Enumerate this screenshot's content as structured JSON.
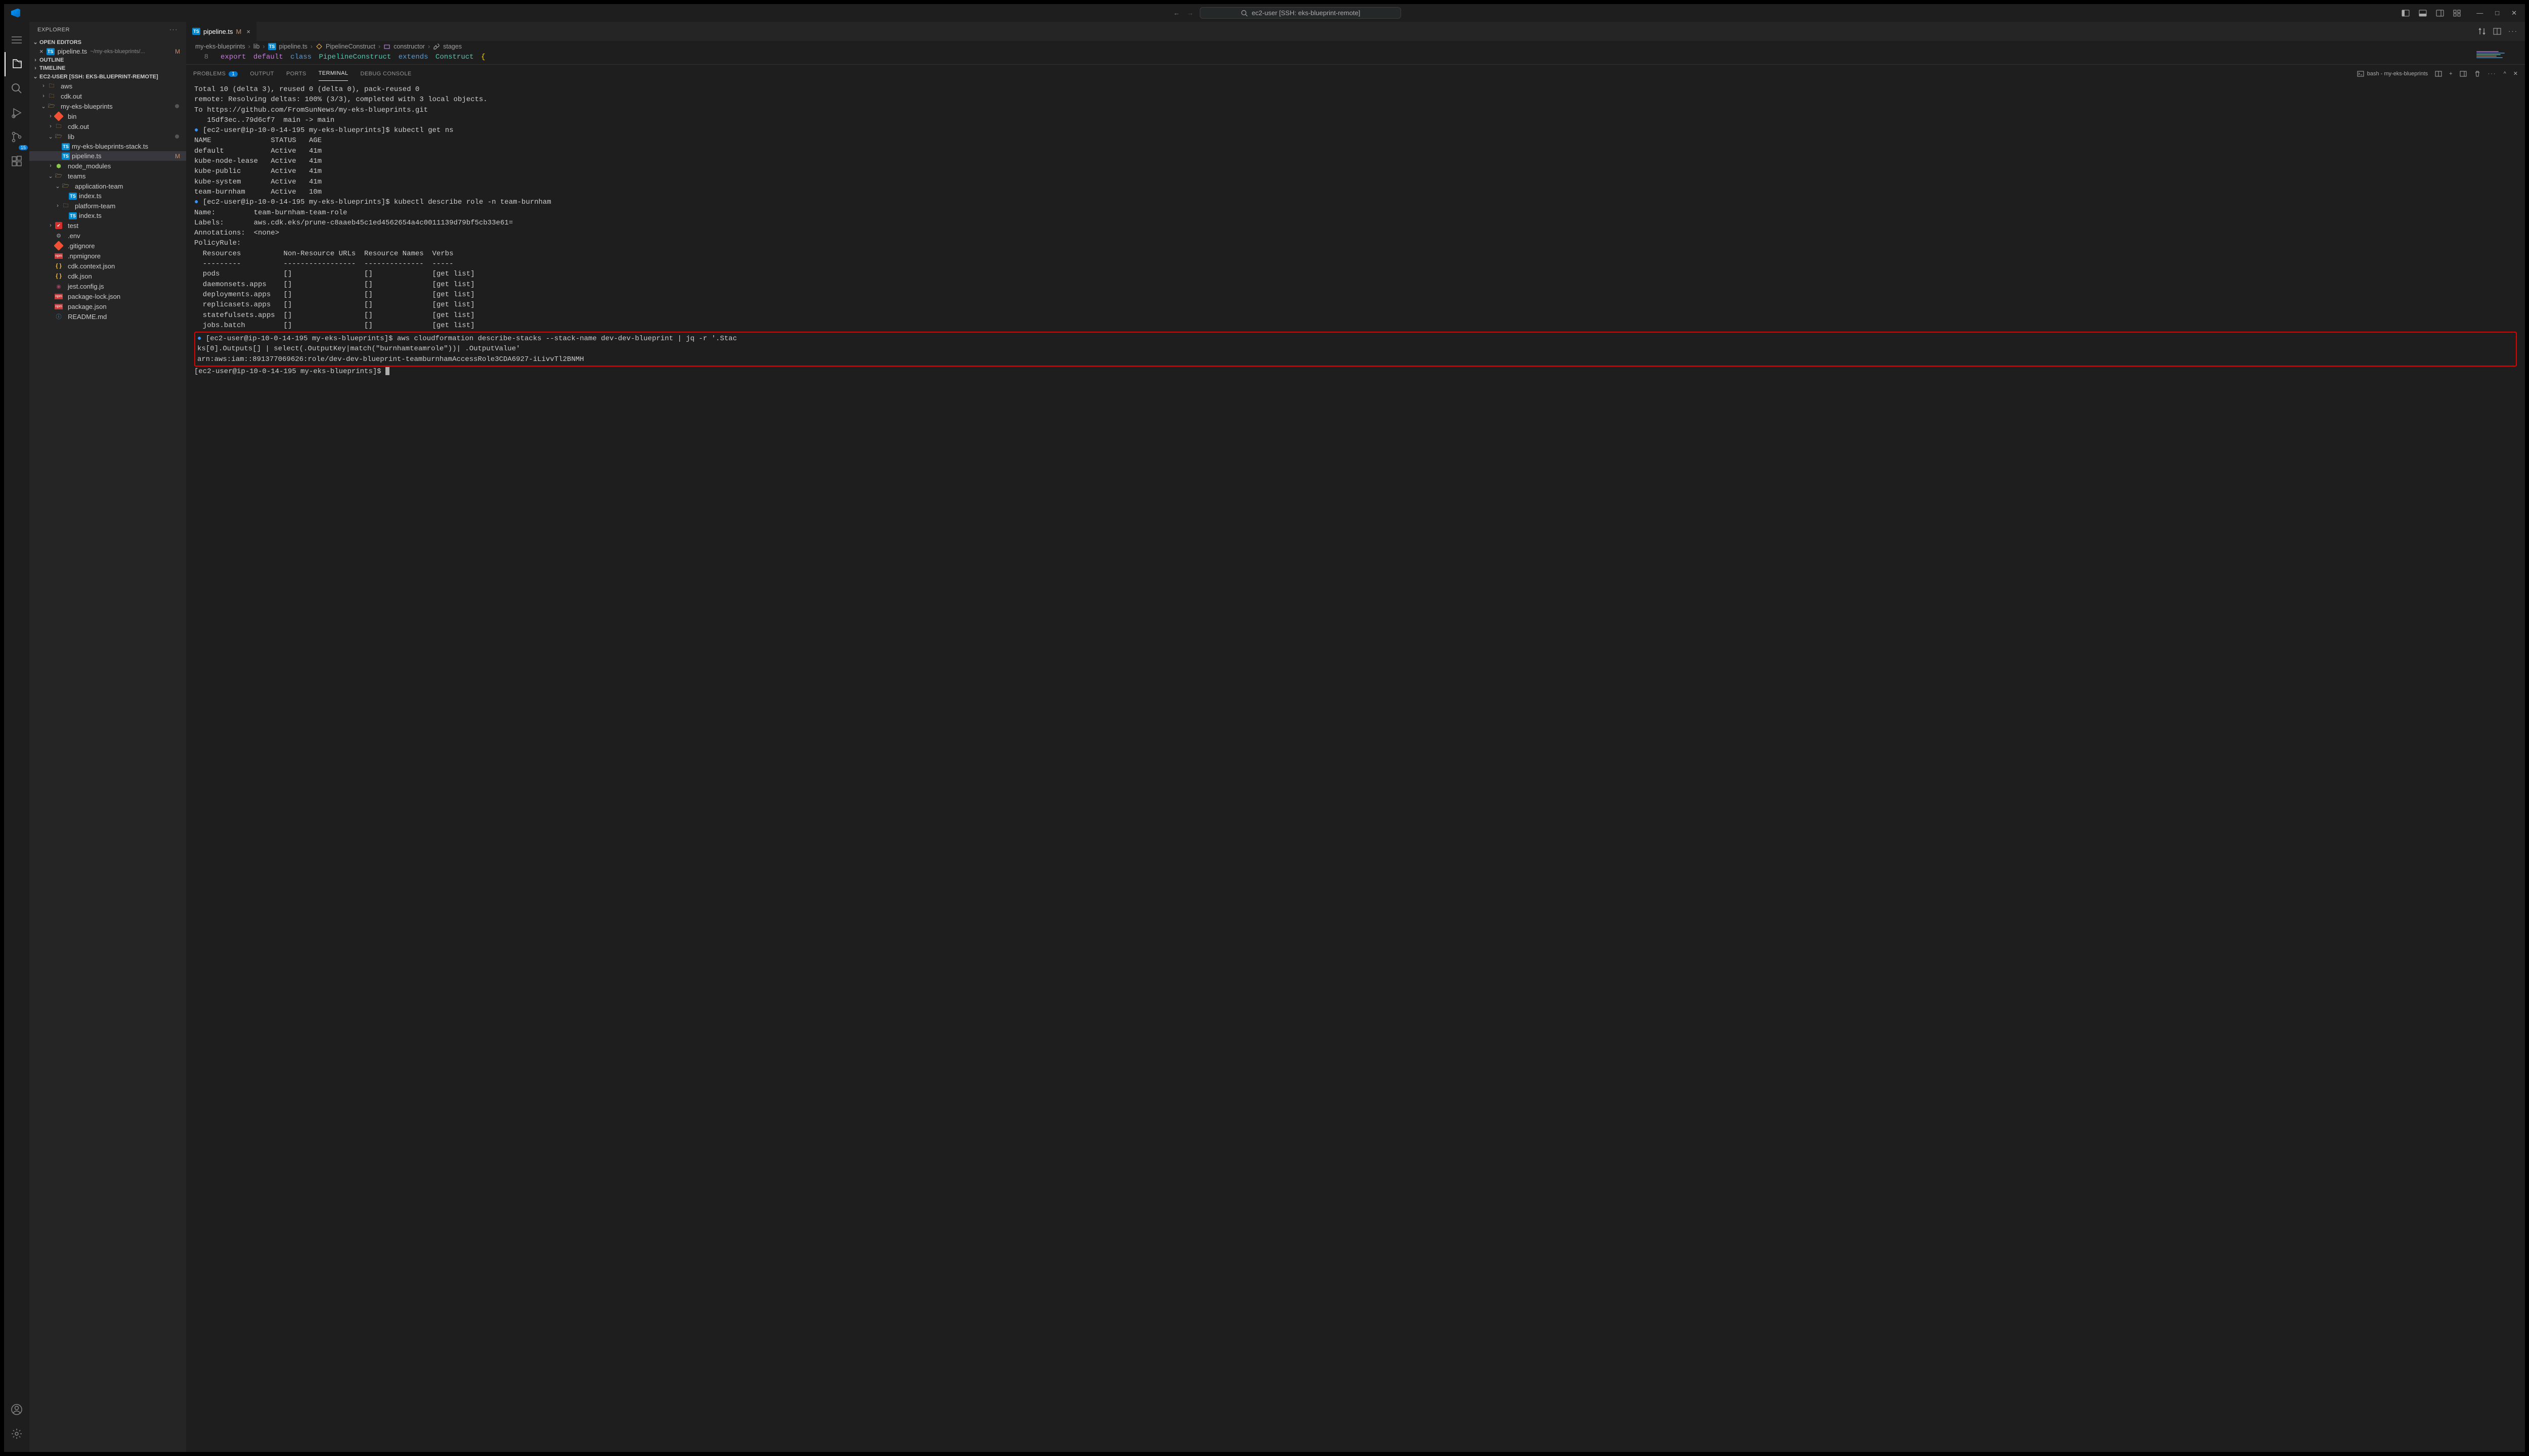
{
  "titlebar": {
    "search_text": "ec2-user [SSH: eks-blueprint-remote]"
  },
  "sidebar": {
    "title": "EXPLORER",
    "sections": {
      "open_editors": "OPEN EDITORS",
      "outline": "OUTLINE",
      "timeline": "TIMELINE",
      "workspace": "EC2-USER [SSH: EKS-BLUEPRINT-REMOTE]"
    },
    "open_editor_item": {
      "name": "pipeline.ts",
      "path": "~/my-eks-blueprints/...",
      "badge": "M",
      "close": "×"
    },
    "tree": [
      {
        "indent": 1,
        "chev": "›",
        "type": "folder",
        "name": "aws"
      },
      {
        "indent": 1,
        "chev": "›",
        "type": "folder",
        "name": "cdk.out"
      },
      {
        "indent": 1,
        "chev": "⌄",
        "type": "folder-open",
        "name": "my-eks-blueprints",
        "dot": true
      },
      {
        "indent": 2,
        "chev": "›",
        "type": "git",
        "name": "bin"
      },
      {
        "indent": 2,
        "chev": "›",
        "type": "folder",
        "name": "cdk.out"
      },
      {
        "indent": 2,
        "chev": "⌄",
        "type": "folder-open",
        "name": "lib",
        "dot": true
      },
      {
        "indent": 3,
        "chev": "",
        "type": "ts",
        "name": "my-eks-blueprints-stack.ts"
      },
      {
        "indent": 3,
        "chev": "",
        "type": "ts",
        "name": "pipeline.ts",
        "badge": "M",
        "active": true
      },
      {
        "indent": 2,
        "chev": "›",
        "type": "node",
        "name": "node_modules"
      },
      {
        "indent": 2,
        "chev": "⌄",
        "type": "folder-open",
        "name": "teams"
      },
      {
        "indent": 3,
        "chev": "⌄",
        "type": "folder-open",
        "name": "application-team"
      },
      {
        "indent": 4,
        "chev": "",
        "type": "ts",
        "name": "index.ts"
      },
      {
        "indent": 3,
        "chev": "›",
        "type": "folder",
        "name": "platform-team"
      },
      {
        "indent": 4,
        "chev": "",
        "type": "ts",
        "name": "index.ts"
      },
      {
        "indent": 2,
        "chev": "›",
        "type": "test",
        "name": "test"
      },
      {
        "indent": 2,
        "chev": "",
        "type": "gear",
        "name": ".env"
      },
      {
        "indent": 2,
        "chev": "",
        "type": "gitfile",
        "name": ".gitignore"
      },
      {
        "indent": 2,
        "chev": "",
        "type": "npm",
        "name": ".npmignore"
      },
      {
        "indent": 2,
        "chev": "",
        "type": "brace",
        "name": "cdk.context.json"
      },
      {
        "indent": 2,
        "chev": "",
        "type": "brace",
        "name": "cdk.json"
      },
      {
        "indent": 2,
        "chev": "",
        "type": "jest",
        "name": "jest.config.js"
      },
      {
        "indent": 2,
        "chev": "",
        "type": "npm",
        "name": "package-lock.json"
      },
      {
        "indent": 2,
        "chev": "",
        "type": "npm",
        "name": "package.json"
      },
      {
        "indent": 2,
        "chev": "",
        "type": "readme",
        "name": "README.md"
      }
    ]
  },
  "tab": {
    "name": "pipeline.ts",
    "badge": "M"
  },
  "breadcrumb": [
    "my-eks-blueprints",
    "lib",
    "pipeline.ts",
    "PipelineConstruct",
    "constructor",
    "stages"
  ],
  "code": {
    "lineno": "8",
    "tokens": {
      "export": "export",
      "default": "default",
      "class": "class",
      "name": "PipelineConstruct",
      "extends": "extends",
      "base": "Construct",
      "brace": "{"
    }
  },
  "panel": {
    "tabs": {
      "problems": "PROBLEMS",
      "problems_badge": "1",
      "output": "OUTPUT",
      "ports": "PORTS",
      "terminal": "TERMINAL",
      "debug": "DEBUG CONSOLE"
    },
    "shell_label": "bash - my-eks-blueprints"
  },
  "terminal": {
    "lines": [
      "Total 10 (delta 3), reused 0 (delta 0), pack-reused 0",
      "remote: Resolving deltas: 100% (3/3), completed with 3 local objects.",
      "To https://github.com/FromSunNews/my-eks-blueprints.git",
      "   15df3ec..79d6cf7  main -> main"
    ],
    "prompt1": "[ec2-user@ip-10-0-14-195 my-eks-blueprints]$ ",
    "cmd1": "kubectl get ns",
    "ns_table": [
      "NAME              STATUS   AGE",
      "default           Active   41m",
      "kube-node-lease   Active   41m",
      "kube-public       Active   41m",
      "kube-system       Active   41m",
      "team-burnham      Active   10m"
    ],
    "prompt2": "[ec2-user@ip-10-0-14-195 my-eks-blueprints]$ ",
    "cmd2": "kubectl describe role -n team-burnham",
    "role_lines": [
      "Name:         team-burnham-team-role",
      "Labels:       aws.cdk.eks/prune-c8aaeb45c1ed4562654a4c0011139d79bf5cb33e61=",
      "Annotations:  <none>",
      "PolicyRule:",
      "  Resources          Non-Resource URLs  Resource Names  Verbs",
      "  ---------          -----------------  --------------  -----",
      "  pods               []                 []              [get list]",
      "  daemonsets.apps    []                 []              [get list]",
      "  deployments.apps   []                 []              [get list]",
      "  replicasets.apps   []                 []              [get list]",
      "  statefulsets.apps  []                 []              [get list]",
      "  jobs.batch         []                 []              [get list]"
    ],
    "prompt3": "[ec2-user@ip-10-0-14-195 my-eks-blueprints]$ ",
    "cmd3a": "aws cloudformation describe-stacks --stack-name dev-dev-blueprint | jq -r '.Stac",
    "cmd3b": "ks[0].Outputs[] | select(.OutputKey|match(\"burnhamteamrole\"))| .OutputValue'",
    "result3": "arn:aws:iam::891377069626:role/dev-dev-blueprint-teamburnhamAccessRole3CDA6927-iLivvTl2BNMH",
    "prompt4": "[ec2-user@ip-10-0-14-195 my-eks-blueprints]$ "
  },
  "scm_badge": "15"
}
